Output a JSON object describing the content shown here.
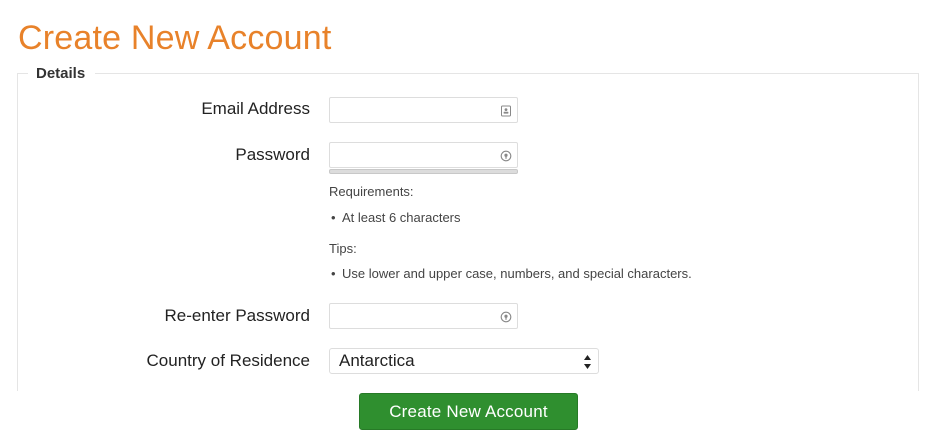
{
  "page": {
    "title": "Create New Account",
    "accent_color": "#e8822a"
  },
  "details": {
    "legend": "Details",
    "email": {
      "label": "Email Address",
      "value": "",
      "icon": "contact-card-icon"
    },
    "password": {
      "label": "Password",
      "value": "",
      "icon": "password-reveal-icon"
    },
    "requirements": {
      "heading": "Requirements:",
      "items": [
        "At least 6 characters"
      ]
    },
    "tips": {
      "heading": "Tips:",
      "items": [
        "Use lower and upper case, numbers, and special characters."
      ]
    },
    "reenter_password": {
      "label": "Re-enter Password",
      "value": "",
      "icon": "password-reveal-icon"
    },
    "country": {
      "label": "Country of Residence",
      "selected": "Antarctica",
      "icon": "select-arrows-icon"
    }
  },
  "actions": {
    "submit_label": "Create New Account",
    "submit_color": "#2f8f2f"
  },
  "bullet_char": "•"
}
